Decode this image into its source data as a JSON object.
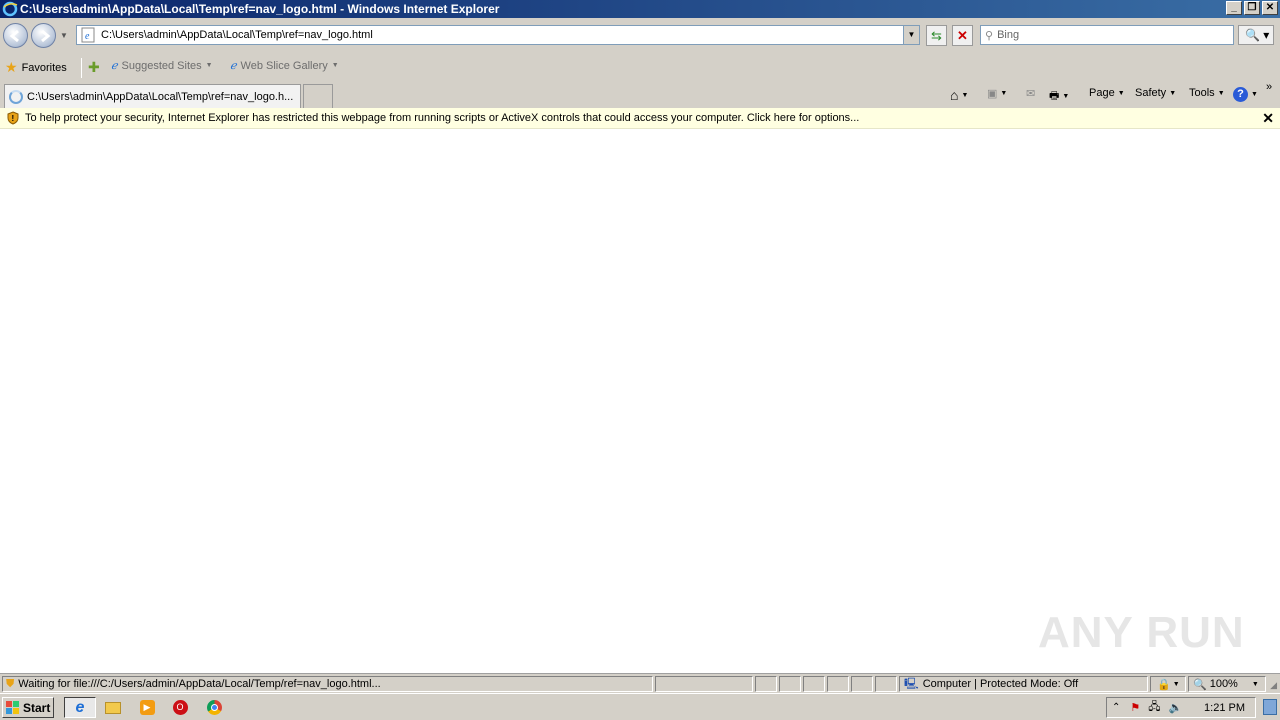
{
  "window": {
    "title": "C:\\Users\\admin\\AppData\\Local\\Temp\\ref=nav_logo.html - Windows Internet Explorer"
  },
  "address_bar": {
    "url": "C:\\Users\\admin\\AppData\\Local\\Temp\\ref=nav_logo.html"
  },
  "search": {
    "placeholder": "Bing"
  },
  "favorites_bar": {
    "favorites_label": "Favorites",
    "suggested_sites": "Suggested Sites",
    "web_slice_gallery": "Web Slice Gallery"
  },
  "tab": {
    "label": "C:\\Users\\admin\\AppData\\Local\\Temp\\ref=nav_logo.h..."
  },
  "command_bar": {
    "page": "Page",
    "safety": "Safety",
    "tools": "Tools"
  },
  "info_bar": {
    "message": "To help protect your security, Internet Explorer has restricted this webpage from running scripts or ActiveX controls that could access your computer. Click here for options..."
  },
  "status_bar": {
    "status": "Waiting for file:///C:/Users/admin/AppData/Local/Temp/ref=nav_logo.html...",
    "zone": "Computer | Protected Mode: Off",
    "zoom": "100%"
  },
  "taskbar": {
    "start_label": "Start",
    "clock": "1:21 PM"
  },
  "watermark": "ANY RUN"
}
